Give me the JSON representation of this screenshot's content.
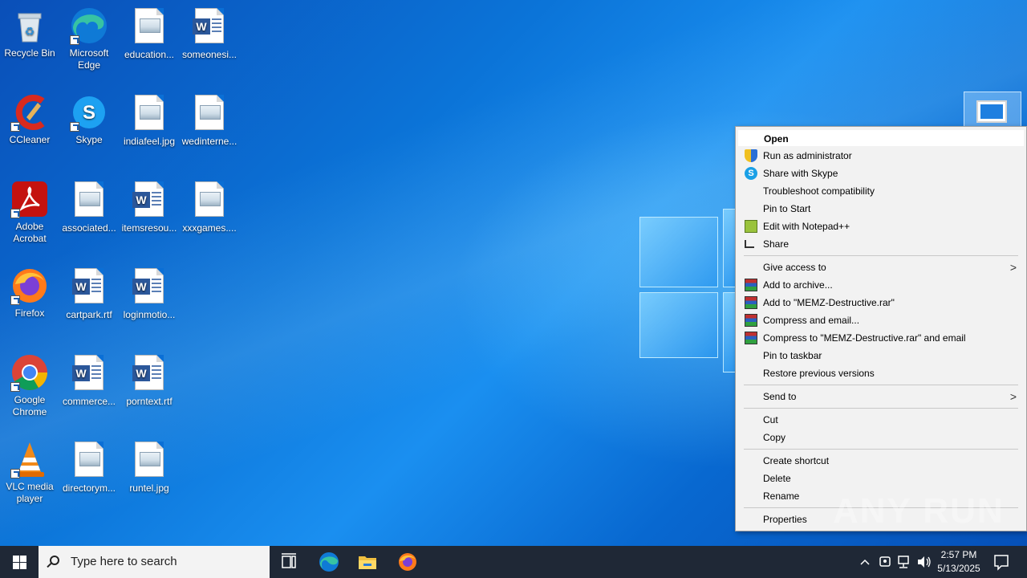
{
  "desktop": {
    "icons": [
      {
        "label": "Recycle Bin",
        "icon": "recycle-bin-icon"
      },
      {
        "label": "Microsoft Edge",
        "icon": "edge-icon"
      },
      {
        "label": "education...",
        "icon": "image-file-icon"
      },
      {
        "label": "someonesi...",
        "icon": "word-file-icon"
      },
      {
        "label": "CCleaner",
        "icon": "ccleaner-icon"
      },
      {
        "label": "Skype",
        "icon": "skype-icon"
      },
      {
        "label": "indiafeel.jpg",
        "icon": "image-file-icon"
      },
      {
        "label": "wedinterne...",
        "icon": "image-file-icon"
      },
      {
        "label": "Adobe Acrobat",
        "icon": "acrobat-icon"
      },
      {
        "label": "associated...",
        "icon": "image-file-icon"
      },
      {
        "label": "itemsresou...",
        "icon": "word-file-icon"
      },
      {
        "label": "xxxgames....",
        "icon": "image-file-icon"
      },
      {
        "label": "Firefox",
        "icon": "firefox-icon"
      },
      {
        "label": "cartpark.rtf",
        "icon": "word-file-icon"
      },
      {
        "label": "loginmotio...",
        "icon": "word-file-icon"
      },
      {
        "label": "Google Chrome",
        "icon": "chrome-icon"
      },
      {
        "label": "commerce...",
        "icon": "word-file-icon"
      },
      {
        "label": "porntext.rtf",
        "icon": "word-file-icon"
      },
      {
        "label": "VLC media player",
        "icon": "vlc-icon"
      },
      {
        "label": "directorym...",
        "icon": "image-file-icon"
      },
      {
        "label": "runtel.jpg",
        "icon": "image-file-icon"
      }
    ]
  },
  "context_menu": {
    "items": {
      "open": "Open",
      "run_admin": "Run as administrator",
      "share_skype": "Share with Skype",
      "troubleshoot": "Troubleshoot compatibility",
      "pin_start": "Pin to Start",
      "edit_npp": "Edit with Notepad++",
      "share": "Share",
      "give_access": "Give access to",
      "add_archive": "Add to archive...",
      "add_rar": "Add to \"MEMZ-Destructive.rar\"",
      "compress_email": "Compress and email...",
      "compress_rar_email": "Compress to \"MEMZ-Destructive.rar\" and email",
      "pin_taskbar": "Pin to taskbar",
      "restore": "Restore previous versions",
      "send_to": "Send to",
      "cut": "Cut",
      "copy": "Copy",
      "create_shortcut": "Create shortcut",
      "delete": "Delete",
      "rename": "Rename",
      "properties": "Properties"
    }
  },
  "watermark": "ANY RUN",
  "taskbar": {
    "search_placeholder": "Type here to search",
    "time": "2:57 PM",
    "date": "5/13/2025"
  }
}
